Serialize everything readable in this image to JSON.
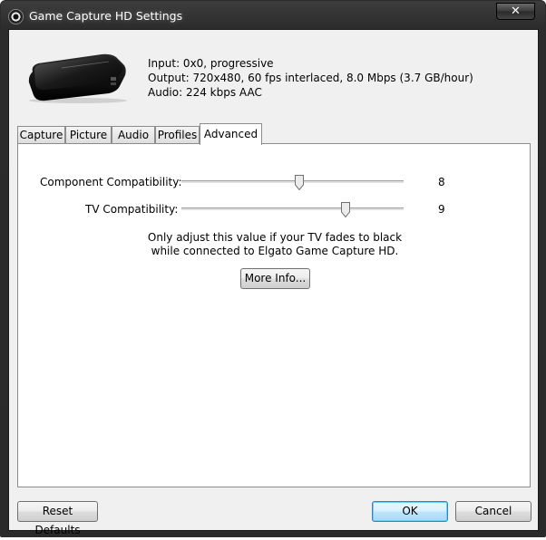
{
  "window": {
    "title": "Game Capture HD Settings",
    "close_label": "✕"
  },
  "device_info": {
    "input": "Input: 0x0,  progressive",
    "output": "Output: 720x480, 60 fps interlaced, 8.0 Mbps (3.7 GB/hour)",
    "audio": "Audio: 224 kbps AAC"
  },
  "tabs": [
    {
      "label": "Capture",
      "active": false
    },
    {
      "label": "Picture",
      "active": false
    },
    {
      "label": "Audio",
      "active": false
    },
    {
      "label": "Profiles",
      "active": false
    },
    {
      "label": "Advanced",
      "active": true
    }
  ],
  "advanced": {
    "component": {
      "label": "Component Compatibility:",
      "value": "8"
    },
    "tv": {
      "label": "TV Compatibility:",
      "value": "9"
    },
    "note_line1": "Only adjust this value if your TV fades to black",
    "note_line2": "while connected to Elgato Game Capture HD.",
    "more_info_label": "More Info..."
  },
  "footer": {
    "reset_label": "Reset Defaults",
    "ok_label": "OK",
    "cancel_label": "Cancel"
  },
  "colors": {
    "titlebar": "#2c2c2c",
    "client_bg": "#f0f0f0",
    "default_button_border": "#3c7fb1"
  }
}
